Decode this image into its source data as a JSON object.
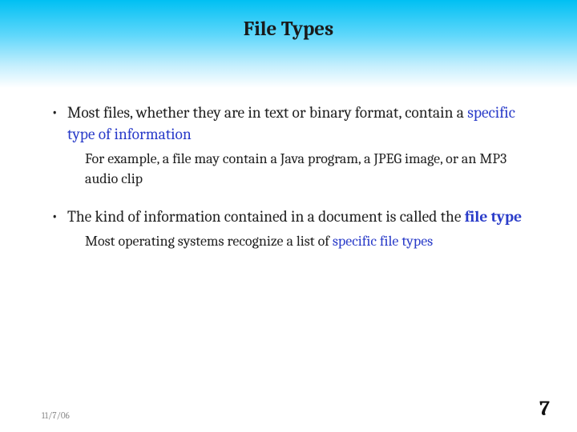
{
  "slide": {
    "title": "File Types",
    "bullets": [
      {
        "main_pre": "Most files, whether they are in text or binary format, contain a ",
        "main_accent": "specific type of information",
        "main_post": "",
        "sub": "For example, a file may contain a Java program, a JPEG image, or an MP3 audio clip"
      },
      {
        "main_pre": "The kind of information contained in a document is called the ",
        "main_accent": "file type",
        "main_post": "",
        "sub_pre": "Most operating systems recognize a list of ",
        "sub_accent": "specific file types",
        "sub_post": ""
      }
    ]
  },
  "footer": {
    "date": "11/7/06",
    "page": "7"
  }
}
